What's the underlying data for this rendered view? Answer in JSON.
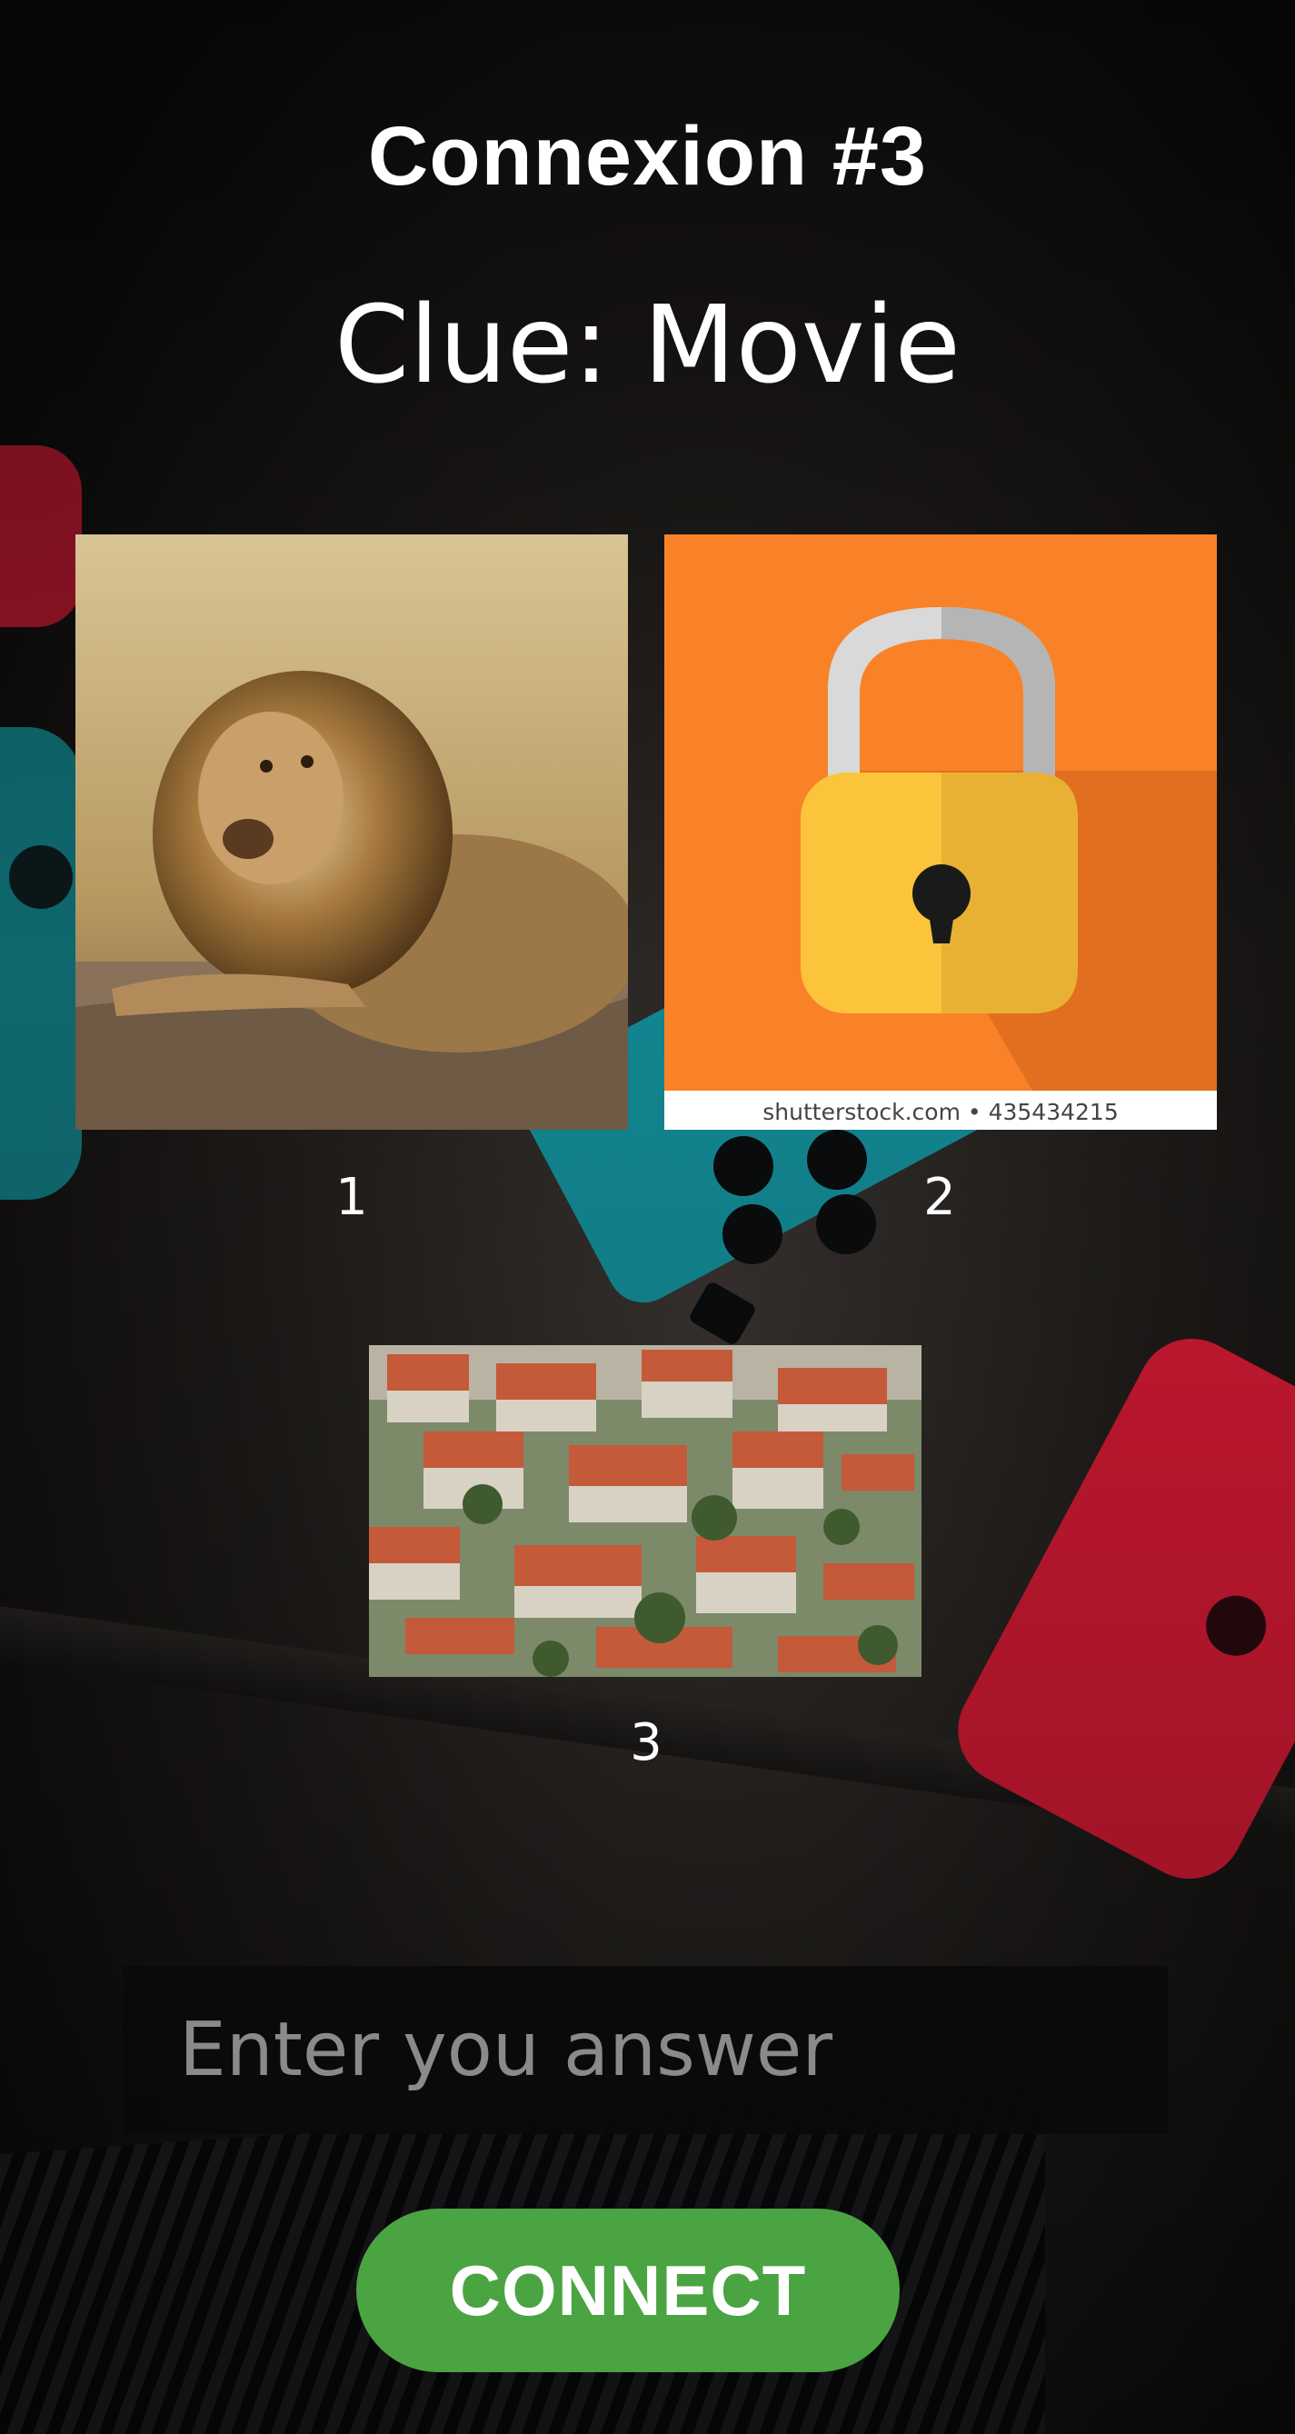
{
  "header": {
    "title": "Connexion #3",
    "clue": "Clue: Movie"
  },
  "images": [
    {
      "number": "1",
      "subject": "lion"
    },
    {
      "number": "2",
      "subject": "padlock",
      "watermark": "shutterstock.com • 435434215"
    },
    {
      "number": "3",
      "subject": "village"
    }
  ],
  "answer": {
    "placeholder": "Enter you answer",
    "value": ""
  },
  "connect_button": {
    "label": "CONNECT",
    "color": "#4aa441"
  }
}
